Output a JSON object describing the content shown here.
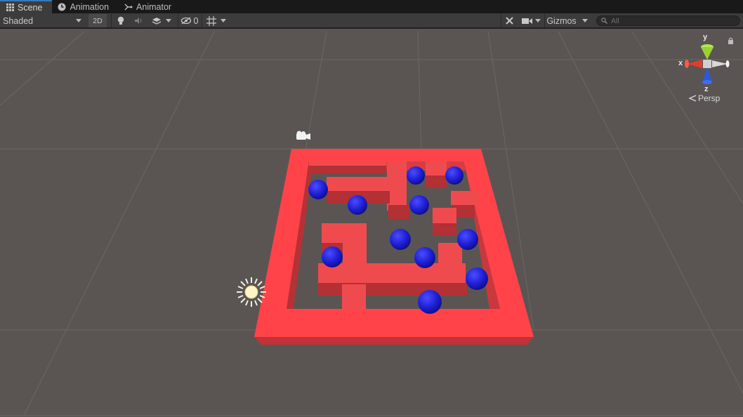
{
  "tabs": [
    {
      "label": "Scene",
      "icon": "grid-icon",
      "active": true
    },
    {
      "label": "Animation",
      "icon": "clock-icon",
      "active": false
    },
    {
      "label": "Animator",
      "icon": "node-icon",
      "active": false
    }
  ],
  "toolbar": {
    "draw_mode": "Shaded",
    "mode_2d": "2D",
    "hidden_count": "0",
    "gizmos_label": "Gizmos",
    "search_placeholder": "All"
  },
  "gizmo": {
    "x_label": "x",
    "y_label": "y",
    "z_label": "z",
    "projection": "Persp"
  },
  "colors": {
    "wall": "#e84a4d",
    "ball": "#1f1fd6",
    "viewport": "#5a5553"
  }
}
